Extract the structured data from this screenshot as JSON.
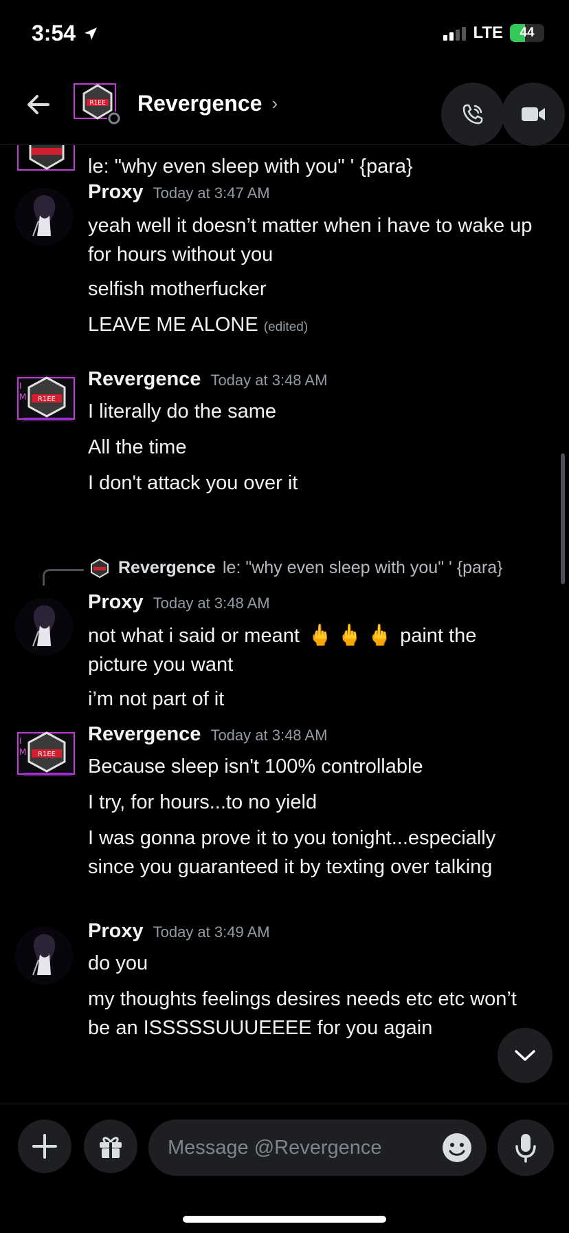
{
  "status_bar": {
    "time": "3:54",
    "network": "LTE",
    "battery": "44",
    "battery_level": 0.44
  },
  "header": {
    "title": "Revergence",
    "chevron": "›"
  },
  "messages": {
    "top_partial": "le: \"why even sleep with you\" ' {para}",
    "group1": {
      "author": "Proxy",
      "timestamp": "Today at 3:47 AM",
      "lines": [
        "yeah well it doesn’t matter when i have to wake up for hours without you",
        "selfish motherfucker",
        "LEAVE ME ALONE"
      ],
      "edited": "(edited)"
    },
    "group2": {
      "author": "Revergence",
      "timestamp": "Today at 3:48 AM",
      "lines": [
        "I literally do the same",
        "All the time",
        "I don't attack you over it"
      ]
    },
    "group3": {
      "reply_author": "Revergence",
      "reply_text": "le: \"why even sleep with you\" ' {para}",
      "author": "Proxy",
      "timestamp": "Today at 3:48 AM",
      "line1_before": "not what i said or meant",
      "line1_after": "paint the",
      "line1_cont": "picture you want",
      "line2": "i’m not part of it"
    },
    "group4": {
      "author": "Revergence",
      "timestamp": "Today at 3:48 AM",
      "lines": [
        "Because sleep isn't 100% controllable",
        "I try, for hours...to no yield",
        "I was gonna prove it to you tonight...especially since you guaranteed it by texting over talking"
      ]
    },
    "group5": {
      "author": "Proxy",
      "timestamp": "Today at 3:49 AM",
      "lines": [
        "do you",
        "my thoughts feelings desires needs etc etc won’t be an ISSSSSUUUEEEE for you again"
      ]
    }
  },
  "composer": {
    "placeholder": "Message @Revergence"
  },
  "icons": {
    "location": "location-arrow-icon",
    "back": "arrow-left-icon",
    "call": "phone-icon",
    "video": "video-camera-icon",
    "plus": "plus-icon",
    "gift": "gift-icon",
    "emoji": "smiley-icon",
    "mic": "microphone-icon",
    "scroll_down": "chevron-down-icon"
  },
  "colors": {
    "background": "#000000",
    "surface": "#1e1f22",
    "text": "#f2f3f5",
    "muted": "#949ba4",
    "battery_green": "#34c759"
  }
}
